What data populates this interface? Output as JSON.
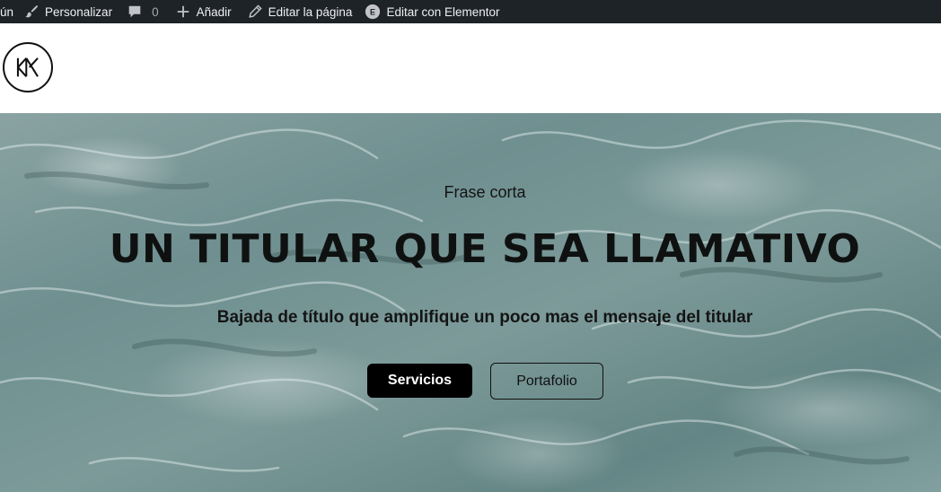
{
  "admin_bar": {
    "cut_item": "ún",
    "customize": "Personalizar",
    "comments_count": "0",
    "add_new": "Añadir",
    "edit_page": "Editar la página",
    "edit_elementor": "Editar con Elementor",
    "elementor_badge": "E"
  },
  "header": {
    "logo_icon": "km-monogram-logo"
  },
  "hero": {
    "eyebrow": "Frase corta",
    "headline": "UN TITULAR QUE SEA LLAMATIVO",
    "subtitle": "Bajada de título que amplifique un poco mas el mensaje del titular",
    "primary_button": "Servicios",
    "secondary_button": "Portafolio"
  },
  "colors": {
    "admin_bar_bg": "#1d2327",
    "water_base": "#7c9a99",
    "button_primary": "#000000"
  }
}
